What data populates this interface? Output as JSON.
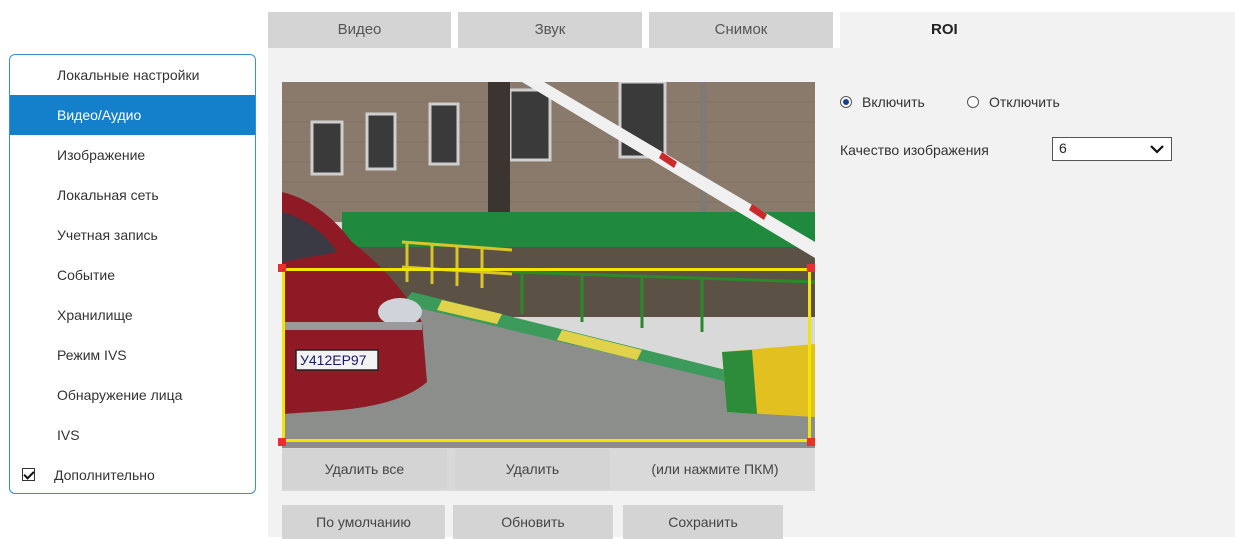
{
  "tabs": [
    {
      "label": "Видео",
      "active": false
    },
    {
      "label": "Звук",
      "active": false
    },
    {
      "label": "Снимок",
      "active": false
    },
    {
      "label": "ROI",
      "active": true
    }
  ],
  "sidebar": {
    "items": [
      {
        "label": "Локальные настройки",
        "active": false
      },
      {
        "label": "Видео/Аудио",
        "active": true
      },
      {
        "label": "Изображение",
        "active": false
      },
      {
        "label": "Локальная сеть",
        "active": false
      },
      {
        "label": "Учетная запись",
        "active": false
      },
      {
        "label": "Событие",
        "active": false
      },
      {
        "label": "Хранилище",
        "active": false
      },
      {
        "label": "Режим IVS",
        "active": false
      },
      {
        "label": "Обнаружение лица",
        "active": false
      },
      {
        "label": "IVS",
        "active": false
      }
    ],
    "advanced": {
      "label": "Дополнительно",
      "checked": true
    }
  },
  "roi": {
    "enable_label": "Включить",
    "disable_label": "Отключить",
    "enabled": true,
    "quality_label": "Качество изображения",
    "quality_value": "6"
  },
  "video": {
    "plate_text": "У412ЕР97",
    "delete_all_label": "Удалить все",
    "delete_label": "Удалить",
    "hint_text": "(или нажмите ПКМ)"
  },
  "footer": {
    "default_label": "По умолчанию",
    "refresh_label": "Обновить",
    "save_label": "Сохранить"
  },
  "colors": {
    "accent": "#1480cc",
    "roi_border": "#f2e600",
    "roi_handle": "#e83030"
  }
}
